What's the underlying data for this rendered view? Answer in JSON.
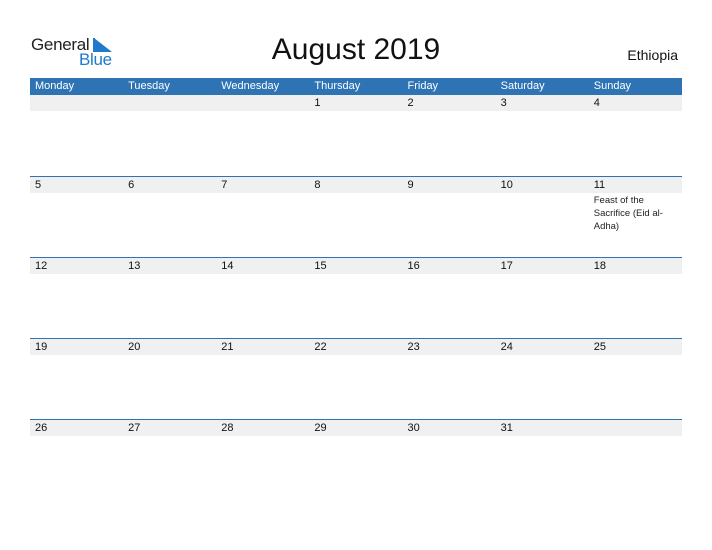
{
  "logo": {
    "word1": "General",
    "word2": "Blue"
  },
  "title": "August 2019",
  "country": "Ethiopia",
  "colors": {
    "accent": "#2e74b5",
    "date_strip": "#f0f0f0",
    "logo_blue": "#1f7ac9"
  },
  "weekdays": [
    "Monday",
    "Tuesday",
    "Wednesday",
    "Thursday",
    "Friday",
    "Saturday",
    "Sunday"
  ],
  "weeks": [
    {
      "days": [
        "",
        "",
        "",
        "1",
        "2",
        "3",
        "4"
      ],
      "events": [
        "",
        "",
        "",
        "",
        "",
        "",
        ""
      ]
    },
    {
      "days": [
        "5",
        "6",
        "7",
        "8",
        "9",
        "10",
        "11"
      ],
      "events": [
        "",
        "",
        "",
        "",
        "",
        "",
        "Feast of the Sacrifice (Eid al-Adha)"
      ]
    },
    {
      "days": [
        "12",
        "13",
        "14",
        "15",
        "16",
        "17",
        "18"
      ],
      "events": [
        "",
        "",
        "",
        "",
        "",
        "",
        ""
      ]
    },
    {
      "days": [
        "19",
        "20",
        "21",
        "22",
        "23",
        "24",
        "25"
      ],
      "events": [
        "",
        "",
        "",
        "",
        "",
        "",
        ""
      ]
    },
    {
      "days": [
        "26",
        "27",
        "28",
        "29",
        "30",
        "31",
        ""
      ],
      "events": [
        "",
        "",
        "",
        "",
        "",
        "",
        ""
      ]
    }
  ]
}
